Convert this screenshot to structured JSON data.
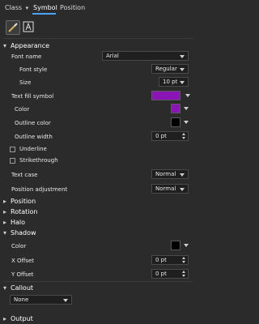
{
  "tabs": {
    "class": "Class",
    "symbol": "Symbol",
    "position": "Position"
  },
  "icons": {
    "brush": "paintbrush-icon",
    "text": "text-symbol-icon"
  },
  "appearance": {
    "title": "Appearance",
    "font_name_label": "Font name",
    "font_name_value": "Arial",
    "font_style_label": "Font style",
    "font_style_value": "Regular",
    "size_label": "Size",
    "size_value": "10 pt",
    "text_fill_label": "Text fill symbol",
    "text_fill_color": "#8a14b6",
    "color_label": "Color",
    "color_value": "#8a14b6",
    "outline_color_label": "Outline color",
    "outline_color_value": "#000000",
    "outline_width_label": "Outline width",
    "outline_width_value": "0 pt",
    "underline_label": "Underline",
    "strikethrough_label": "Strikethrough",
    "text_case_label": "Text case",
    "text_case_value": "Normal",
    "position_adjustment_label": "Position adjustment",
    "position_adjustment_value": "Normal"
  },
  "sections": {
    "position": "Position",
    "rotation": "Rotation",
    "halo": "Halo",
    "shadow": "Shadow",
    "callout": "Callout",
    "output": "Output"
  },
  "shadow": {
    "color_label": "Color",
    "color_value": "#000000",
    "x_offset_label": "X Offset",
    "x_offset_value": "0 pt",
    "y_offset_label": "Y Offset",
    "y_offset_value": "0 pt"
  },
  "callout": {
    "value": "None"
  }
}
